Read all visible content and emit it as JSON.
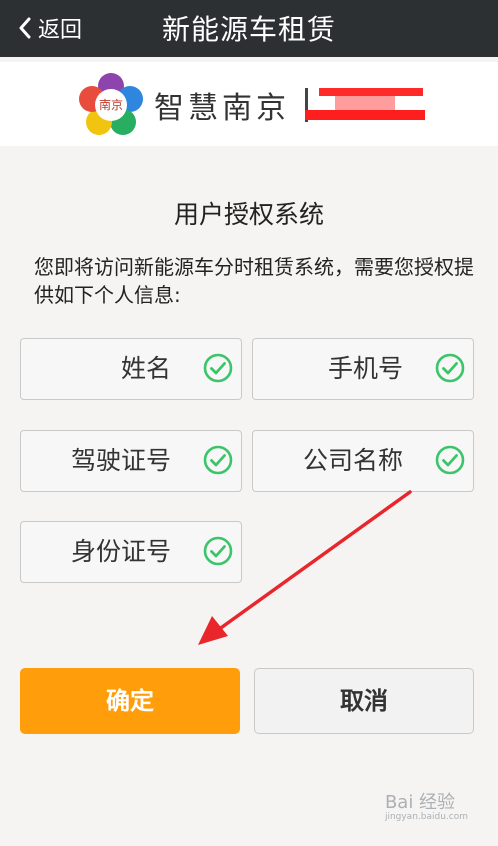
{
  "header": {
    "back_label": "返回",
    "title": "新能源车租赁"
  },
  "brand": {
    "logo_text": "智慧南京",
    "emblem_text": "南京"
  },
  "content": {
    "heading": "用户授权系统",
    "description": "您即将访问新能源车分时租赁系统，需要您授权提供如下个人信息:"
  },
  "fields": [
    {
      "label": "姓名",
      "checked": true
    },
    {
      "label": "手机号",
      "checked": true
    },
    {
      "label": "驾驶证号",
      "checked": true
    },
    {
      "label": "公司名称",
      "checked": true
    },
    {
      "label": "身份证号",
      "checked": true
    }
  ],
  "buttons": {
    "confirm": "确定",
    "cancel": "取消"
  },
  "watermark": {
    "text": "Bai 经验",
    "sub": "jingyan.baidu.com"
  },
  "colors": {
    "topbar": "#2c3033",
    "accent": "#ff9e0a",
    "check": "#3cc46b",
    "arrow": "#e8262b"
  }
}
